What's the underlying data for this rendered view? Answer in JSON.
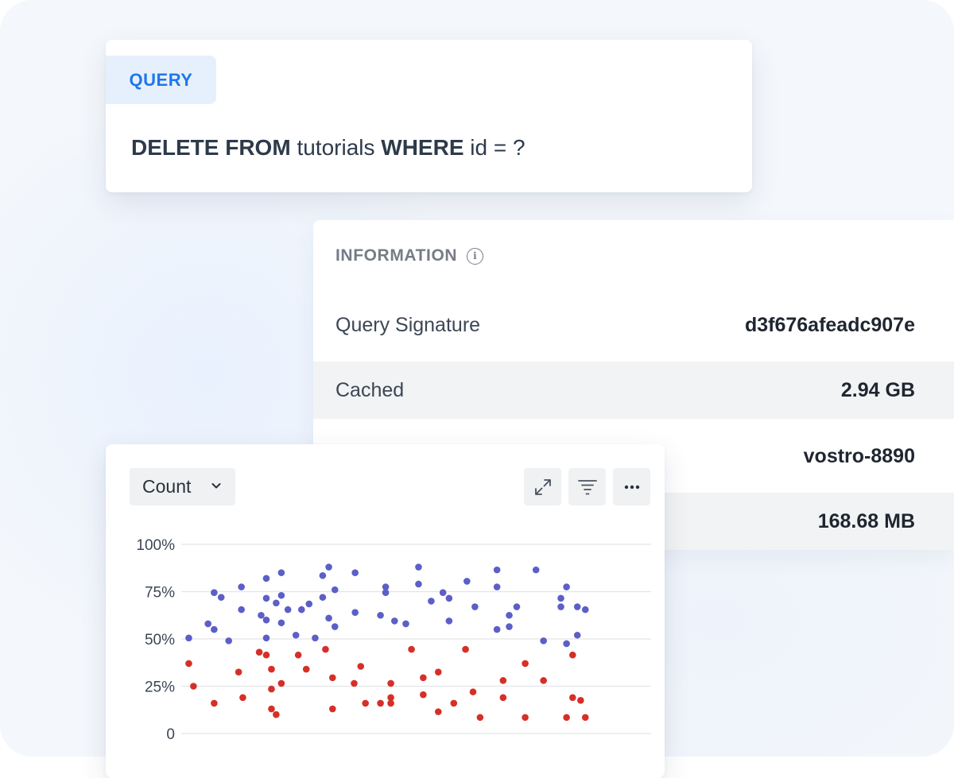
{
  "query": {
    "tab_label": "QUERY",
    "parts": [
      {
        "text": "DELETE FROM",
        "bold": true
      },
      {
        "text": " tutorials ",
        "bold": false
      },
      {
        "text": "WHERE",
        "bold": true
      },
      {
        "text": " id = ?",
        "bold": false
      }
    ]
  },
  "information": {
    "header": "INFORMATION",
    "icon": "info-icon",
    "rows": [
      {
        "label": "Query Signature",
        "value": "d3f676afeadc907e"
      },
      {
        "label": "Cached",
        "value": "2.94 GB"
      },
      {
        "label": "",
        "value": "vostro-8890"
      },
      {
        "label": "",
        "value": "168.68 MB"
      }
    ]
  },
  "chart_panel": {
    "dropdown_label": "Count",
    "dropdown_icon": "chevron-down-icon",
    "tools": [
      {
        "name": "expand-button",
        "icon": "expand-icon"
      },
      {
        "name": "filter-button",
        "icon": "filter-icon"
      },
      {
        "name": "more-button",
        "icon": "more-icon"
      }
    ]
  },
  "chart_data": {
    "type": "scatter",
    "title": "",
    "xlabel": "",
    "ylabel": "",
    "yticks": [
      "0",
      "25%",
      "50%",
      "75%",
      "100%"
    ],
    "ylim": [
      0,
      100
    ],
    "xlim": [
      0,
      100
    ],
    "grid": true,
    "series": [
      {
        "color": "#5b5fc7",
        "points": [
          {
            "x": 1.6,
            "y": 50.5
          },
          {
            "x": 5.7,
            "y": 58
          },
          {
            "x": 7.0,
            "y": 55
          },
          {
            "x": 7.0,
            "y": 74.5
          },
          {
            "x": 8.5,
            "y": 72
          },
          {
            "x": 10.1,
            "y": 49
          },
          {
            "x": 12.8,
            "y": 65.5
          },
          {
            "x": 12.8,
            "y": 77.5
          },
          {
            "x": 17.0,
            "y": 62.5
          },
          {
            "x": 18.1,
            "y": 50.5
          },
          {
            "x": 18.1,
            "y": 60
          },
          {
            "x": 18.1,
            "y": 71.5
          },
          {
            "x": 18.1,
            "y": 82
          },
          {
            "x": 20.2,
            "y": 69
          },
          {
            "x": 21.3,
            "y": 58.5
          },
          {
            "x": 21.3,
            "y": 73
          },
          {
            "x": 21.3,
            "y": 85
          },
          {
            "x": 22.7,
            "y": 65.5
          },
          {
            "x": 24.4,
            "y": 52
          },
          {
            "x": 25.6,
            "y": 65.5
          },
          {
            "x": 27.2,
            "y": 68.5
          },
          {
            "x": 28.5,
            "y": 50.5
          },
          {
            "x": 30.1,
            "y": 72
          },
          {
            "x": 30.1,
            "y": 83.5
          },
          {
            "x": 31.4,
            "y": 88
          },
          {
            "x": 31.4,
            "y": 61
          },
          {
            "x": 32.7,
            "y": 56.5
          },
          {
            "x": 32.7,
            "y": 76
          },
          {
            "x": 37.0,
            "y": 64
          },
          {
            "x": 37.0,
            "y": 85
          },
          {
            "x": 42.4,
            "y": 62.5
          },
          {
            "x": 43.5,
            "y": 74.5
          },
          {
            "x": 43.5,
            "y": 77.5
          },
          {
            "x": 45.4,
            "y": 59.5
          },
          {
            "x": 47.8,
            "y": 58
          },
          {
            "x": 50.5,
            "y": 79
          },
          {
            "x": 50.5,
            "y": 88
          },
          {
            "x": 53.2,
            "y": 70
          },
          {
            "x": 55.7,
            "y": 74.5
          },
          {
            "x": 57.0,
            "y": 71.5
          },
          {
            "x": 57.0,
            "y": 59.5
          },
          {
            "x": 60.8,
            "y": 80.5
          },
          {
            "x": 62.5,
            "y": 67
          },
          {
            "x": 67.2,
            "y": 55
          },
          {
            "x": 67.2,
            "y": 77.5
          },
          {
            "x": 67.2,
            "y": 86.5
          },
          {
            "x": 69.8,
            "y": 56.5
          },
          {
            "x": 69.8,
            "y": 62.5
          },
          {
            "x": 71.4,
            "y": 67
          },
          {
            "x": 75.5,
            "y": 86.5
          },
          {
            "x": 77.1,
            "y": 49
          },
          {
            "x": 80.8,
            "y": 67
          },
          {
            "x": 80.8,
            "y": 71.5
          },
          {
            "x": 82.0,
            "y": 47.5
          },
          {
            "x": 82.0,
            "y": 77.5
          },
          {
            "x": 84.3,
            "y": 52
          },
          {
            "x": 84.3,
            "y": 67
          },
          {
            "x": 86.0,
            "y": 65.5
          }
        ]
      },
      {
        "color": "#d62f27",
        "points": [
          {
            "x": 1.6,
            "y": 37
          },
          {
            "x": 2.6,
            "y": 25
          },
          {
            "x": 7.0,
            "y": 16
          },
          {
            "x": 12.2,
            "y": 32.5
          },
          {
            "x": 13.1,
            "y": 19
          },
          {
            "x": 16.6,
            "y": 43
          },
          {
            "x": 18.1,
            "y": 41.5
          },
          {
            "x": 19.2,
            "y": 34
          },
          {
            "x": 19.2,
            "y": 23.5
          },
          {
            "x": 19.2,
            "y": 13
          },
          {
            "x": 20.2,
            "y": 10
          },
          {
            "x": 21.3,
            "y": 26.5
          },
          {
            "x": 24.9,
            "y": 41.5
          },
          {
            "x": 26.6,
            "y": 34
          },
          {
            "x": 30.7,
            "y": 44.5
          },
          {
            "x": 32.2,
            "y": 29.5
          },
          {
            "x": 32.2,
            "y": 13
          },
          {
            "x": 36.8,
            "y": 26.5
          },
          {
            "x": 38.2,
            "y": 35.5
          },
          {
            "x": 39.2,
            "y": 16
          },
          {
            "x": 42.4,
            "y": 16
          },
          {
            "x": 44.6,
            "y": 26.5
          },
          {
            "x": 44.6,
            "y": 19
          },
          {
            "x": 44.6,
            "y": 16
          },
          {
            "x": 49.0,
            "y": 44.5
          },
          {
            "x": 51.5,
            "y": 29.5
          },
          {
            "x": 51.5,
            "y": 20.5
          },
          {
            "x": 54.7,
            "y": 32.5
          },
          {
            "x": 54.7,
            "y": 11.5
          },
          {
            "x": 58.0,
            "y": 16
          },
          {
            "x": 60.5,
            "y": 44.5
          },
          {
            "x": 62.1,
            "y": 22
          },
          {
            "x": 63.6,
            "y": 8.5
          },
          {
            "x": 68.5,
            "y": 28
          },
          {
            "x": 68.5,
            "y": 19
          },
          {
            "x": 73.2,
            "y": 37
          },
          {
            "x": 73.2,
            "y": 8.5
          },
          {
            "x": 77.1,
            "y": 28
          },
          {
            "x": 82.0,
            "y": 8.5
          },
          {
            "x": 83.3,
            "y": 41.5
          },
          {
            "x": 83.3,
            "y": 19
          },
          {
            "x": 85.0,
            "y": 17.5
          },
          {
            "x": 86.0,
            "y": 8.5
          }
        ]
      }
    ]
  }
}
